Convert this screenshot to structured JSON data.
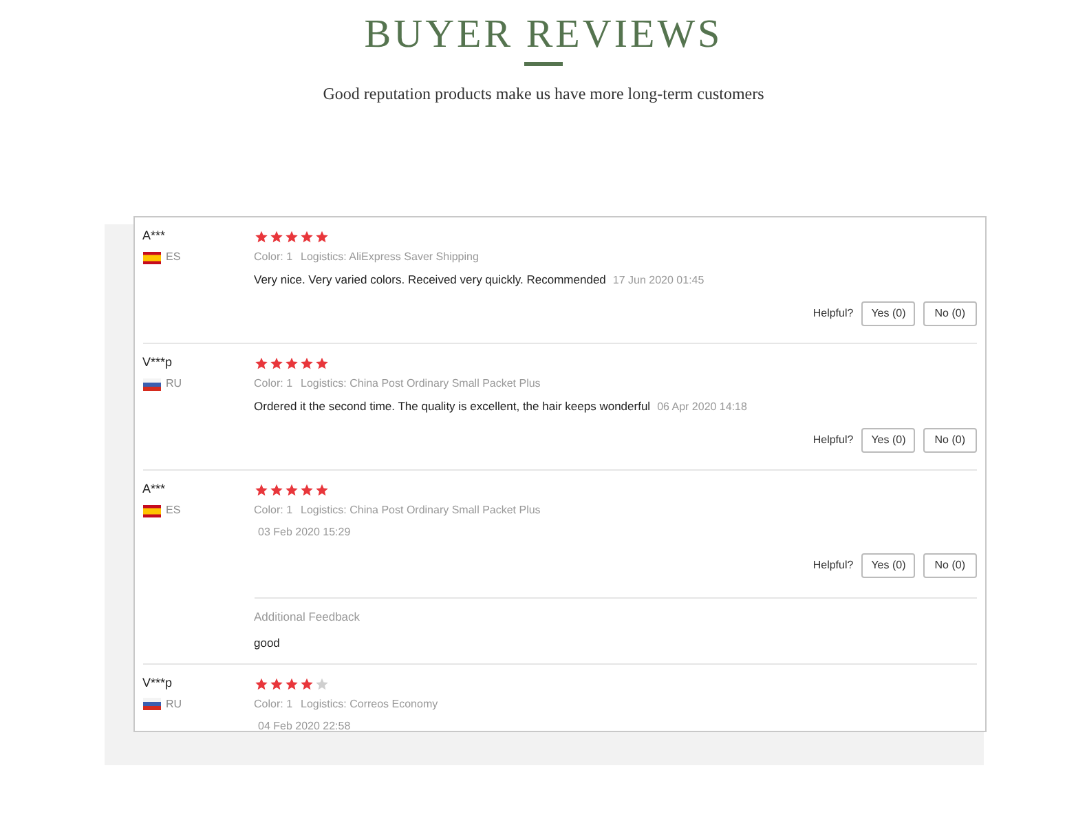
{
  "header": {
    "title": "BUYER REVIEWS",
    "subtitle": "Good reputation products make us have more long-term customers"
  },
  "reviews": [
    {
      "name": "A***",
      "kind": "es",
      "country": "ES",
      "stars": 5,
      "variant": "Color: 1",
      "logistics": "Logistics: AliExpress Saver Shipping",
      "text": "Very nice. Very varied colors. Received very quickly. Recommended",
      "date": "17 Jun 2020 01:45",
      "helpful": "Helpful?",
      "yes": "Yes (0)",
      "no": "No (0)"
    },
    {
      "name": "V***p",
      "kind": "ru",
      "country": "RU",
      "stars": 5,
      "variant": "Color: 1",
      "logistics": "Logistics: China Post Ordinary Small Packet Plus",
      "text": "Ordered it the second time. The quality is excellent, the hair keeps wonderful",
      "date": "06 Apr 2020 14:18",
      "helpful": "Helpful?",
      "yes": "Yes (0)",
      "no": "No (0)"
    },
    {
      "name": "A***",
      "kind": "es",
      "country": "ES",
      "stars": 5,
      "variant": "Color: 1",
      "logistics": "Logistics: China Post Ordinary Small Packet Plus",
      "date": "03 Feb 2020 15:29",
      "helpful": "Helpful?",
      "yes": "Yes (0)",
      "no": "No (0)",
      "additional_label": "Additional Feedback",
      "additional_text": "good"
    },
    {
      "name": "V***p",
      "kind": "ru",
      "country": "RU",
      "stars": 4,
      "variant": "Color: 1",
      "logistics": "Logistics: Correos Economy",
      "date": "04 Feb 2020 22:58"
    }
  ]
}
